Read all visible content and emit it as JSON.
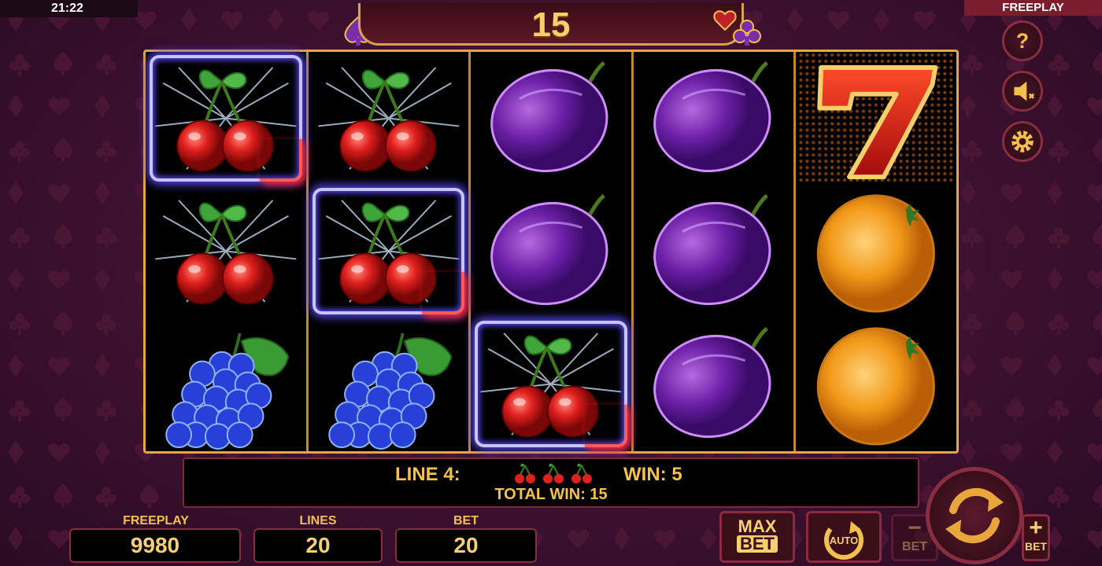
{
  "status": {
    "clock": "21:22",
    "mode": "FREEPLAY"
  },
  "counter": {
    "value": "15"
  },
  "reels": [
    [
      "cherry",
      "cherry",
      "grapes"
    ],
    [
      "cherry",
      "cherry",
      "grapes"
    ],
    [
      "plum",
      "plum",
      "cherry"
    ],
    [
      "plum",
      "plum",
      "plum"
    ],
    [
      "seven",
      "orange",
      "orange"
    ]
  ],
  "highlighted_cells": [
    [
      0,
      0
    ],
    [
      1,
      1
    ],
    [
      2,
      2
    ]
  ],
  "win_info": {
    "line_label": "LINE 4:",
    "line_symbols": [
      "cherry",
      "cherry",
      "cherry"
    ],
    "win_label": "WIN: 5",
    "total_win_label": "TOTAL WIN: 15"
  },
  "stats": {
    "balance_label": "FREEPLAY",
    "balance_value": "9980",
    "lines_label": "LINES",
    "lines_value": "20",
    "bet_label": "BET",
    "bet_value": "20"
  },
  "buttons": {
    "max_bet_top": "MAX",
    "max_bet_bottom": "BET",
    "auto_label": "AUTO",
    "bet_minus_symbol": "−",
    "bet_minus_label": "BET",
    "bet_plus_symbol": "+",
    "bet_plus_label": "BET"
  },
  "side_controls": {
    "help_symbol": "?",
    "icons": [
      "help-icon",
      "sound-muted-icon",
      "settings-gear-icon"
    ]
  },
  "colors": {
    "gold": "#f6c24a",
    "frame": "#e8a63c",
    "background": "#3d1130",
    "highlight_blue": "#5c4dff",
    "highlight_red": "#ff5a5a"
  }
}
